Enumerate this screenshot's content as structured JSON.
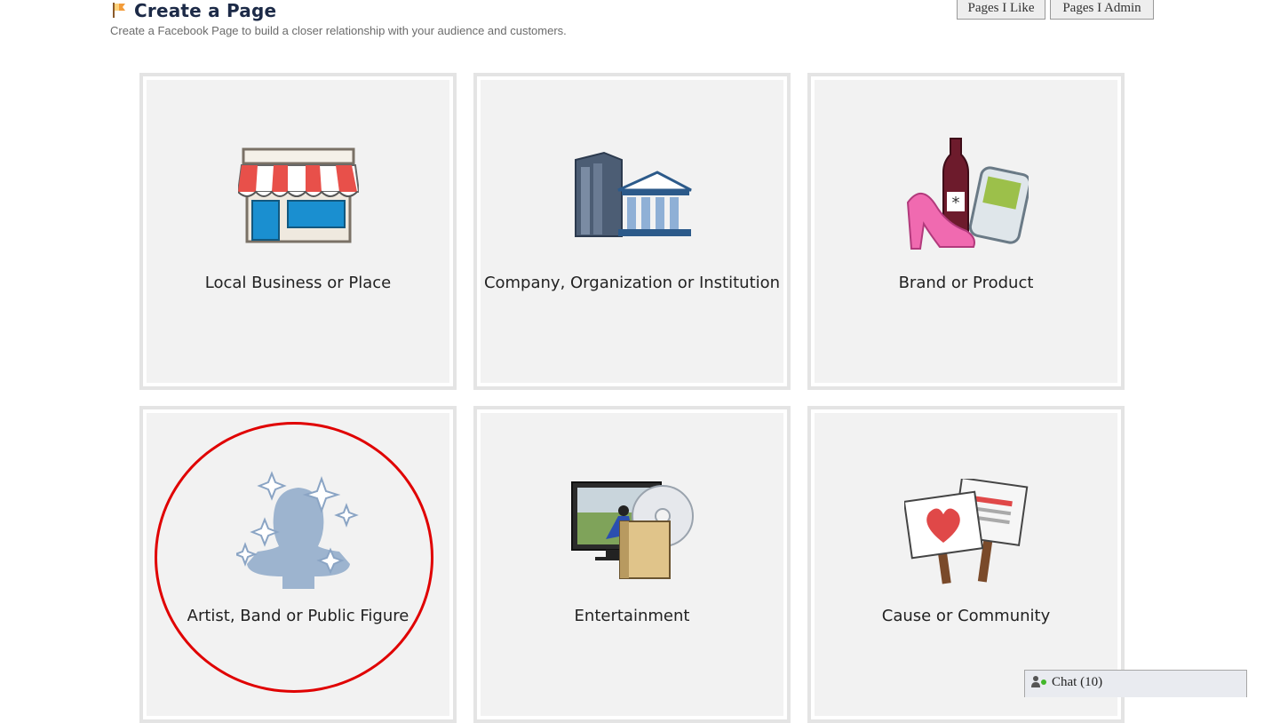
{
  "header": {
    "title": "Create a Page",
    "subtitle": "Create a Facebook Page to build a closer relationship with your audience and customers.",
    "icon": "flag-icon"
  },
  "top_buttons": {
    "pages_i_like": "Pages I Like",
    "pages_i_admin": "Pages I Admin"
  },
  "categories": [
    {
      "label": "Local Business or Place",
      "icon": "storefront-icon"
    },
    {
      "label": "Company, Organization or Institution",
      "icon": "building-icon"
    },
    {
      "label": "Brand or Product",
      "icon": "products-icon"
    },
    {
      "label": "Artist, Band or Public Figure",
      "icon": "public-figure-icon"
    },
    {
      "label": "Entertainment",
      "icon": "entertainment-icon"
    },
    {
      "label": "Cause or Community",
      "icon": "signs-icon"
    }
  ],
  "annotation": {
    "color": "#e00000",
    "target": "Artist, Band or Public Figure"
  },
  "chat": {
    "label": "Chat (10)",
    "status_color": "#42b72a"
  }
}
